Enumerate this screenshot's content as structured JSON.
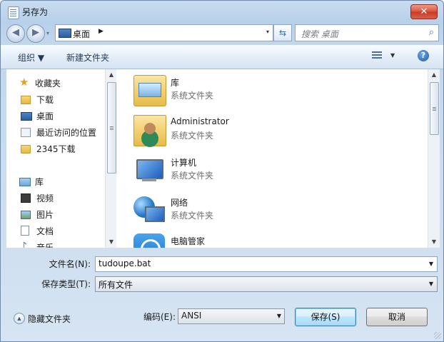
{
  "window": {
    "title": "另存为",
    "close_glyph": "✕"
  },
  "nav": {
    "back_glyph": "◀",
    "forward_glyph": "▶",
    "dropdown_glyph": "▾",
    "breadcrumb": "桌面",
    "crumb_arrow": "▶",
    "refresh_glyph": "⇆",
    "search_placeholder": "搜索 桌面",
    "search_glyph": "⌕"
  },
  "toolbar": {
    "organize": "组织 ▼",
    "new_folder": "新建文件夹",
    "view_dd": "▼",
    "help": "?"
  },
  "sidebar": {
    "favorites": {
      "label": "收藏夹",
      "icon": "star-icon"
    },
    "items": [
      {
        "label": "下载",
        "icon": "download-folder-icon"
      },
      {
        "label": "桌面",
        "icon": "desktop-icon"
      },
      {
        "label": "最近访问的位置",
        "icon": "recent-places-icon"
      },
      {
        "label": "2345下载",
        "icon": "folder-icon"
      }
    ],
    "libraries": {
      "label": "库",
      "icon": "library-icon"
    },
    "lib_items": [
      {
        "label": "视频",
        "icon": "video-icon"
      },
      {
        "label": "图片",
        "icon": "pictures-icon"
      },
      {
        "label": "文档",
        "icon": "documents-icon"
      },
      {
        "label": "音乐",
        "icon": "music-icon"
      }
    ]
  },
  "files": [
    {
      "name": "库",
      "type": "系统文件夹",
      "icon": "library-folder-icon"
    },
    {
      "name": "Administrator",
      "type": "系统文件夹",
      "icon": "user-folder-icon"
    },
    {
      "name": "计算机",
      "type": "系统文件夹",
      "icon": "computer-icon"
    },
    {
      "name": "网络",
      "type": "系统文件夹",
      "icon": "network-icon"
    },
    {
      "name": "电脑管家",
      "type": "",
      "icon": "pc-manager-icon"
    }
  ],
  "form": {
    "filename_label": "文件名(N):",
    "filename_value": "tudoupe.bat",
    "filetype_label": "保存类型(T):",
    "filetype_value": "所有文件"
  },
  "footer": {
    "hide_folders": "隐藏文件夹",
    "encoding_label": "编码(E):",
    "encoding_value": "ANSI",
    "save": "保存(S)",
    "cancel": "取消"
  },
  "scroll": {
    "up": "▲",
    "down": "▼"
  }
}
